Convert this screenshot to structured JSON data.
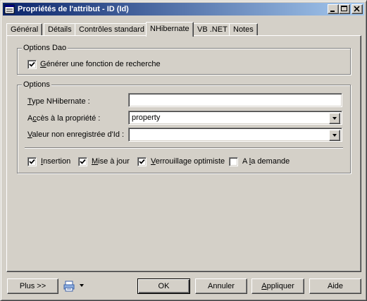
{
  "window": {
    "title": "Propriétés de l'attribut - ID (Id)"
  },
  "tabs": [
    {
      "label": "Général"
    },
    {
      "label": "Détails"
    },
    {
      "label": "Contrôles standard"
    },
    {
      "label": "NHibernate"
    },
    {
      "label": "VB .NET"
    },
    {
      "label": "Notes"
    }
  ],
  "active_tab": "NHibernate",
  "dao": {
    "title": "Options Dao",
    "gen_pre": "",
    "gen_key": "G",
    "gen_post": "énérer une fonction de recherche",
    "checked": true
  },
  "options": {
    "title": "Options",
    "type_pre": "",
    "type_key": "T",
    "type_post": "ype NHibernate :",
    "type_value": "",
    "acces_pre": "A",
    "acces_key": "c",
    "acces_post": "cès à la propriété :",
    "acces_value": "property",
    "valeur_pre": "",
    "valeur_key": "V",
    "valeur_post": "aleur non enregistrée d'Id :",
    "valeur_value": ""
  },
  "checkboxes": [
    {
      "pre": "",
      "key": "I",
      "post": "nsertion",
      "checked": true
    },
    {
      "pre": "",
      "key": "M",
      "post": "ise à jour",
      "checked": true
    },
    {
      "pre": "",
      "key": "V",
      "post": "errouillage optimiste",
      "checked": true
    },
    {
      "pre": "A ",
      "key": "l",
      "post": "a demande",
      "checked": false
    }
  ],
  "buttons": {
    "plus": "Plus >>",
    "ok": "OK",
    "annuler": "Annuler",
    "appliquer_key": "A",
    "appliquer_post": "ppliquer",
    "aide": "Aide"
  },
  "icons": {
    "window": "properties-window-icon",
    "print": "print-icon",
    "dropdown": "chevron-down-icon"
  }
}
